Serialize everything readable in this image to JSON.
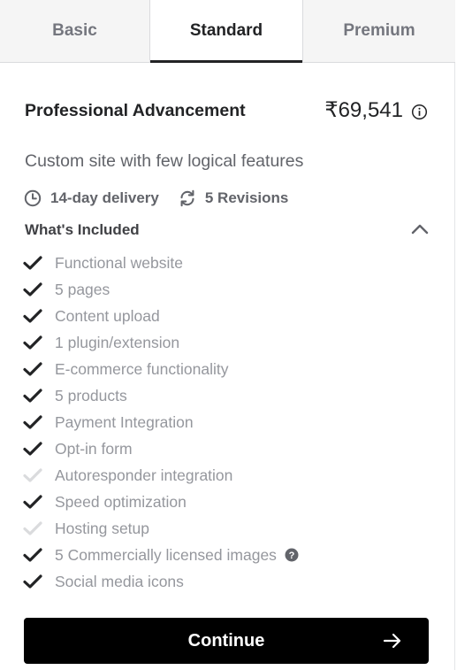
{
  "tabs": [
    {
      "label": "Basic",
      "active": false
    },
    {
      "label": "Standard",
      "active": true
    },
    {
      "label": "Premium",
      "active": false
    }
  ],
  "package": {
    "title": "Professional Advancement",
    "price": "₹69,541",
    "description": "Custom site with few logical features"
  },
  "meta": {
    "delivery": "14-day delivery",
    "revisions": "5 Revisions"
  },
  "included": {
    "title": "What's Included",
    "features": [
      {
        "label": "Functional website",
        "included": true
      },
      {
        "label": "5 pages",
        "included": true
      },
      {
        "label": "Content upload",
        "included": true
      },
      {
        "label": "1 plugin/extension",
        "included": true
      },
      {
        "label": "E-commerce functionality",
        "included": true
      },
      {
        "label": "5 products",
        "included": true
      },
      {
        "label": "Payment Integration",
        "included": true
      },
      {
        "label": "Opt-in form",
        "included": true
      },
      {
        "label": "Autoresponder integration",
        "included": false
      },
      {
        "label": "Speed optimization",
        "included": true
      },
      {
        "label": "Hosting setup",
        "included": false
      },
      {
        "label": "5 Commercially licensed images",
        "included": true,
        "help": true
      },
      {
        "label": "Social media icons",
        "included": true
      }
    ]
  },
  "cta": {
    "label": "Continue"
  },
  "colors": {
    "included_check": "#222325",
    "excluded_check": "#dadbdd",
    "feature_text": "#95979d",
    "button_bg": "#000000",
    "button_text": "#ffffff"
  }
}
